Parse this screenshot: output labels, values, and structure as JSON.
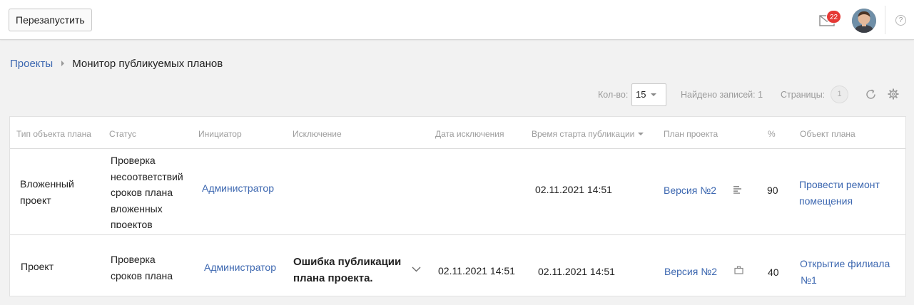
{
  "toolbar": {
    "restart_label": "Перезапустить"
  },
  "header": {
    "mail_count": "22",
    "help_symbol": "?"
  },
  "breadcrumb": {
    "root": "Проекты",
    "current": "Монитор публикуемых планов"
  },
  "pager": {
    "count_label": "Кол-во:",
    "count_value": "15",
    "found_label": "Найдено записей: 1",
    "pages_label": "Страницы:",
    "current_page": "1"
  },
  "table": {
    "columns": [
      "Тип объекта плана",
      "Статус",
      "Инициатор",
      "Исключение",
      "Дата исключения",
      "Время старта публикации",
      "План проекта",
      "%",
      "Объект плана"
    ],
    "rows": [
      {
        "type_line1": "Вложенный",
        "type_line2": "проект",
        "status": [
          "Проверка",
          "несоответствий",
          "сроков плана",
          "вложенных",
          "проектов"
        ],
        "initiator": "Администратор",
        "exception": [
          "",
          ""
        ],
        "exception_date": "",
        "start_time": "02.11.2021 14:51",
        "plan": "Версия №2",
        "plan_icon": "gantt-icon",
        "percent": "90",
        "object": [
          "Провести ремонт",
          "помещения"
        ]
      },
      {
        "type_line1": "Проект",
        "type_line2": "",
        "status": [
          "Проверка",
          "сроков плана"
        ],
        "initiator": "Администратор",
        "exception": [
          "Ошибка публикации",
          "плана проекта."
        ],
        "exception_date": "02.11.2021 14:51",
        "start_time": "02.11.2021 14:51",
        "plan": "Версия №2",
        "plan_icon": "briefcase-icon",
        "percent": "40",
        "object": [
          "Открытие филиала",
          "№1"
        ]
      }
    ]
  },
  "colors": {
    "link": "#3c67b0",
    "badge": "#e53935"
  }
}
